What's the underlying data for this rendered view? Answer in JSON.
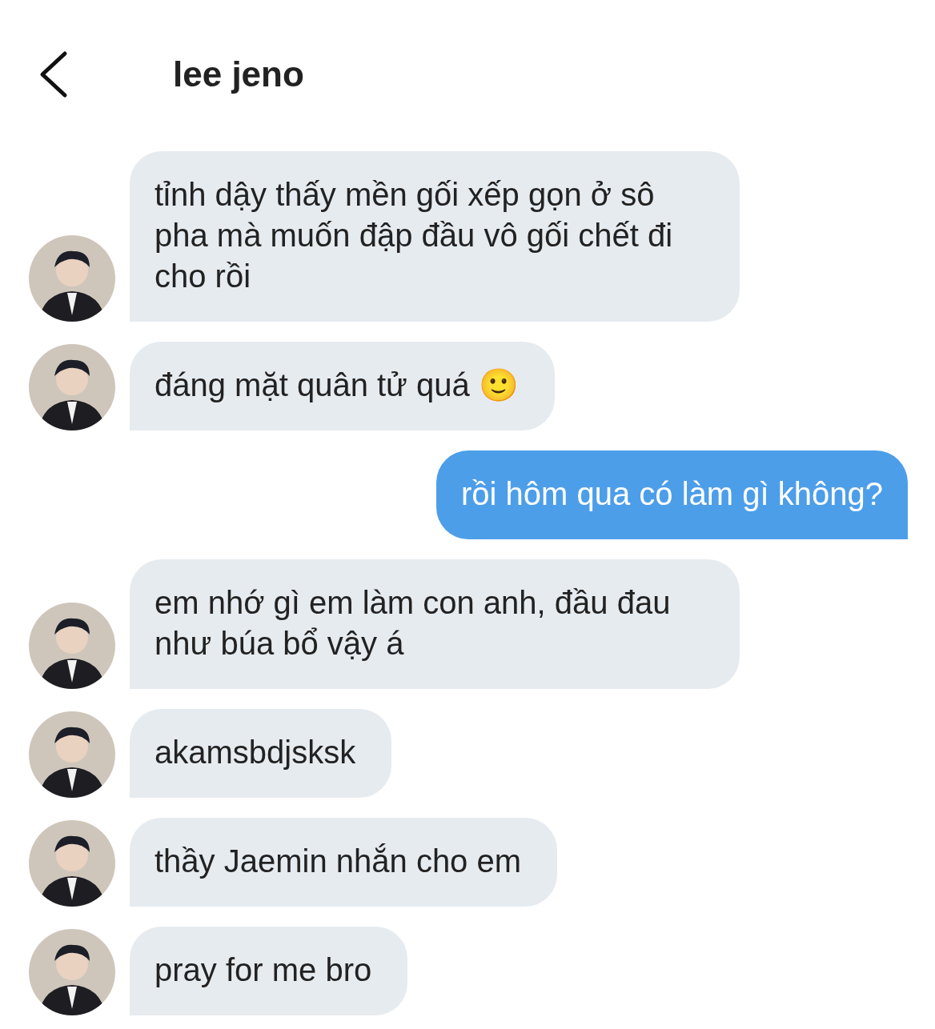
{
  "header": {
    "title": "lee jeno"
  },
  "messages": [
    {
      "kind": "received",
      "text": "tỉnh dậy thấy mền gối xếp gọn ở sô pha mà muốn đập đầu vô gối chết đi cho rồi"
    },
    {
      "kind": "received",
      "text": "đáng mặt quân tử quá 🙂"
    },
    {
      "kind": "sent",
      "text": "rồi hôm qua có làm gì không?"
    },
    {
      "kind": "received",
      "text": "em nhớ gì em làm con anh, đầu đau như búa bổ vậy á"
    },
    {
      "kind": "received",
      "text": "akamsbdjsksk"
    },
    {
      "kind": "received",
      "text": "thầy Jaemin nhắn cho em"
    },
    {
      "kind": "received",
      "text": "pray for me bro"
    }
  ]
}
